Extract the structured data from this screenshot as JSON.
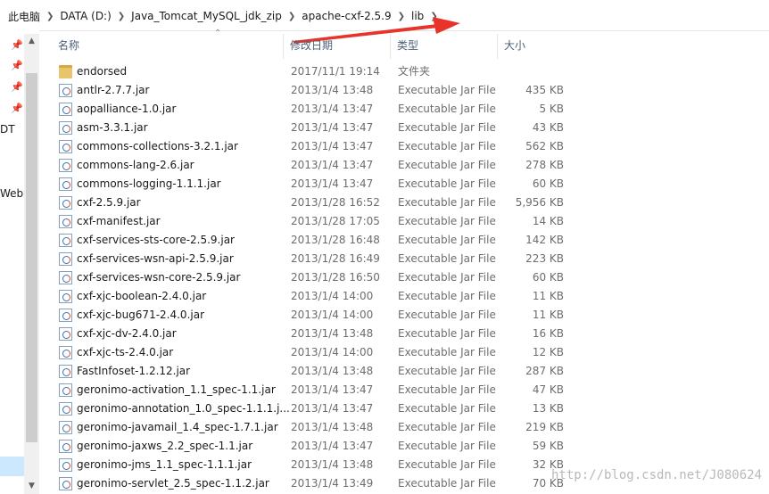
{
  "address_bar": {
    "crumbs": [
      "此电脑",
      "DATA (D:)",
      "Java_Tomcat_MySQL_jdk_zip",
      "apache-cxf-2.5.9",
      "lib"
    ]
  },
  "nav_pane": {
    "partial_labels": [
      "DT",
      "WebS"
    ]
  },
  "columns": {
    "name": "名称",
    "date": "修改日期",
    "type": "类型",
    "size": "大小"
  },
  "files": [
    {
      "name": "endorsed",
      "date": "2017/11/1 19:14",
      "type": "文件夹",
      "size": "",
      "icon": "folder-icon"
    },
    {
      "name": "antlr-2.7.7.jar",
      "date": "2013/1/4 13:48",
      "type": "Executable Jar File",
      "size": "435 KB",
      "icon": "jar-file-icon"
    },
    {
      "name": "aopalliance-1.0.jar",
      "date": "2013/1/4 13:47",
      "type": "Executable Jar File",
      "size": "5 KB",
      "icon": "jar-file-icon"
    },
    {
      "name": "asm-3.3.1.jar",
      "date": "2013/1/4 13:47",
      "type": "Executable Jar File",
      "size": "43 KB",
      "icon": "jar-file-icon"
    },
    {
      "name": "commons-collections-3.2.1.jar",
      "date": "2013/1/4 13:47",
      "type": "Executable Jar File",
      "size": "562 KB",
      "icon": "jar-file-icon"
    },
    {
      "name": "commons-lang-2.6.jar",
      "date": "2013/1/4 13:47",
      "type": "Executable Jar File",
      "size": "278 KB",
      "icon": "jar-file-icon"
    },
    {
      "name": "commons-logging-1.1.1.jar",
      "date": "2013/1/4 13:47",
      "type": "Executable Jar File",
      "size": "60 KB",
      "icon": "jar-file-icon"
    },
    {
      "name": "cxf-2.5.9.jar",
      "date": "2013/1/28 16:52",
      "type": "Executable Jar File",
      "size": "5,956 KB",
      "icon": "jar-file-icon"
    },
    {
      "name": "cxf-manifest.jar",
      "date": "2013/1/28 17:05",
      "type": "Executable Jar File",
      "size": "14 KB",
      "icon": "jar-file-icon"
    },
    {
      "name": "cxf-services-sts-core-2.5.9.jar",
      "date": "2013/1/28 16:48",
      "type": "Executable Jar File",
      "size": "142 KB",
      "icon": "jar-file-icon"
    },
    {
      "name": "cxf-services-wsn-api-2.5.9.jar",
      "date": "2013/1/28 16:49",
      "type": "Executable Jar File",
      "size": "223 KB",
      "icon": "jar-file-icon"
    },
    {
      "name": "cxf-services-wsn-core-2.5.9.jar",
      "date": "2013/1/28 16:50",
      "type": "Executable Jar File",
      "size": "60 KB",
      "icon": "jar-file-icon"
    },
    {
      "name": "cxf-xjc-boolean-2.4.0.jar",
      "date": "2013/1/4 14:00",
      "type": "Executable Jar File",
      "size": "11 KB",
      "icon": "jar-file-icon"
    },
    {
      "name": "cxf-xjc-bug671-2.4.0.jar",
      "date": "2013/1/4 14:00",
      "type": "Executable Jar File",
      "size": "11 KB",
      "icon": "jar-file-icon"
    },
    {
      "name": "cxf-xjc-dv-2.4.0.jar",
      "date": "2013/1/4 13:48",
      "type": "Executable Jar File",
      "size": "16 KB",
      "icon": "jar-file-icon"
    },
    {
      "name": "cxf-xjc-ts-2.4.0.jar",
      "date": "2013/1/4 14:00",
      "type": "Executable Jar File",
      "size": "12 KB",
      "icon": "jar-file-icon"
    },
    {
      "name": "FastInfoset-1.2.12.jar",
      "date": "2013/1/4 13:48",
      "type": "Executable Jar File",
      "size": "287 KB",
      "icon": "jar-file-icon"
    },
    {
      "name": "geronimo-activation_1.1_spec-1.1.jar",
      "date": "2013/1/4 13:47",
      "type": "Executable Jar File",
      "size": "47 KB",
      "icon": "jar-file-icon"
    },
    {
      "name": "geronimo-annotation_1.0_spec-1.1.1.j...",
      "date": "2013/1/4 13:47",
      "type": "Executable Jar File",
      "size": "13 KB",
      "icon": "jar-file-icon"
    },
    {
      "name": "geronimo-javamail_1.4_spec-1.7.1.jar",
      "date": "2013/1/4 13:48",
      "type": "Executable Jar File",
      "size": "219 KB",
      "icon": "jar-file-icon"
    },
    {
      "name": "geronimo-jaxws_2.2_spec-1.1.jar",
      "date": "2013/1/4 13:47",
      "type": "Executable Jar File",
      "size": "59 KB",
      "icon": "jar-file-icon"
    },
    {
      "name": "geronimo-jms_1.1_spec-1.1.1.jar",
      "date": "2013/1/4 13:48",
      "type": "Executable Jar File",
      "size": "32 KB",
      "icon": "jar-file-icon"
    },
    {
      "name": "geronimo-servlet_2.5_spec-1.1.2.jar",
      "date": "2013/1/4 13:49",
      "type": "Executable Jar File",
      "size": "70 KB",
      "icon": "jar-file-icon"
    }
  ],
  "watermark": "http://blog.csdn.net/J080624",
  "colors": {
    "annotation_arrow": "#e8332a",
    "header_text": "#4c607a",
    "folder": "#e8c46b",
    "selection": "#cce8ff"
  }
}
